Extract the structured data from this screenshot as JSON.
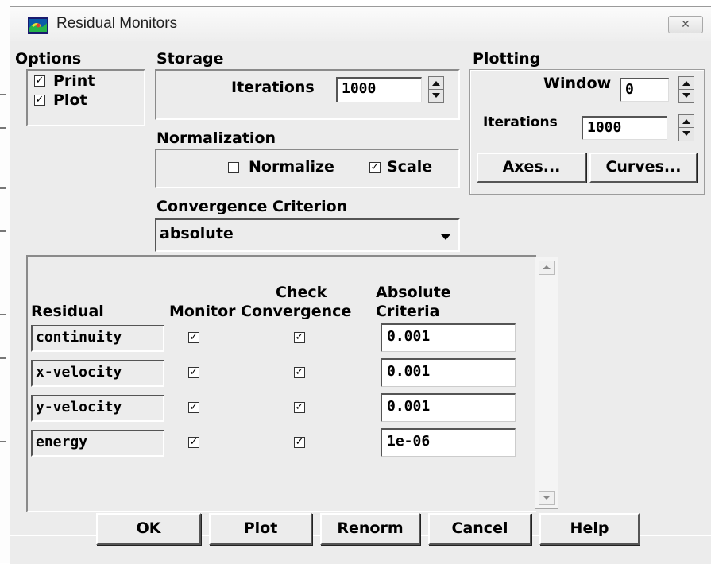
{
  "window": {
    "title": "Residual Monitors",
    "close_glyph": "✕",
    "icon": "fluent-app-icon"
  },
  "options": {
    "heading": "Options",
    "print": {
      "label": "Print",
      "checked": true
    },
    "plot": {
      "label": "Plot",
      "checked": true
    }
  },
  "storage": {
    "heading": "Storage",
    "iterations_label": "Iterations",
    "iterations_value": "1000"
  },
  "plotting": {
    "heading": "Plotting",
    "window_label": "Window",
    "window_value": "0",
    "iterations_label": "Iterations",
    "iterations_value": "1000",
    "axes_button": "Axes...",
    "curves_button": "Curves..."
  },
  "normalization": {
    "heading": "Normalization",
    "normalize": {
      "label": "Normalize",
      "checked": false
    },
    "scale": {
      "label": "Scale",
      "checked": true
    }
  },
  "convergence": {
    "heading": "Convergence Criterion",
    "selected": "absolute"
  },
  "table": {
    "headers": {
      "residual": "Residual",
      "monitor": "Monitor",
      "check_line1": "Check",
      "check_line2": "Convergence",
      "criteria_line1": "Absolute",
      "criteria_line2": "Criteria"
    },
    "rows": [
      {
        "name": "continuity",
        "monitor": true,
        "check": true,
        "criteria": "0.001"
      },
      {
        "name": "x-velocity",
        "monitor": true,
        "check": true,
        "criteria": "0.001"
      },
      {
        "name": "y-velocity",
        "monitor": true,
        "check": true,
        "criteria": "0.001"
      },
      {
        "name": "energy",
        "monitor": true,
        "check": true,
        "criteria": "1e-06"
      }
    ]
  },
  "buttons": {
    "ok": "OK",
    "plot": "Plot",
    "renorm": "Renorm",
    "cancel": "Cancel",
    "help": "Help"
  },
  "check_glyph": "✓",
  "colors": {
    "dialog_bg": "#ececec",
    "title_bg": "#f5f5f5"
  }
}
